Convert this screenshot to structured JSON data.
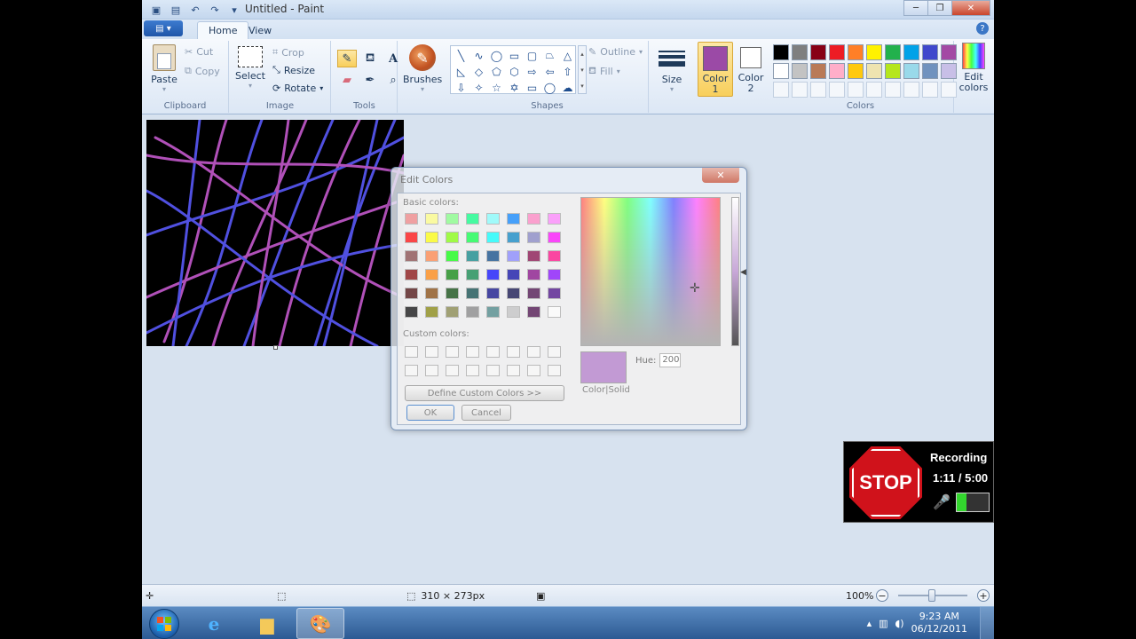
{
  "window": {
    "title": "Untitled - Paint",
    "controls": [
      "─",
      "❐",
      "✕"
    ]
  },
  "qat": {
    "save": "💾",
    "undo": "↶",
    "redo": "↷",
    "more": "▾"
  },
  "tabs": [
    {
      "label": "Home",
      "active": true
    },
    {
      "label": "View",
      "active": false
    }
  ],
  "ribbon": {
    "clipboard": {
      "label": "Clipboard",
      "paste": "Paste",
      "cut": "Cut",
      "copy": "Copy"
    },
    "image": {
      "label": "Image",
      "select": "Select",
      "crop": "Crop",
      "resize": "Resize",
      "rotate": "Rotate"
    },
    "tools": {
      "label": "Tools"
    },
    "brushes": {
      "label": "Brushes"
    },
    "shapes": {
      "label": "Shapes",
      "outline": "Outline",
      "fill": "Fill"
    },
    "size": {
      "label": "Size"
    },
    "colors": {
      "label": "Colors",
      "color1": "Color 1",
      "color2": "Color 2",
      "color1_value": "#9b4aa6",
      "color2_value": "#ffffff",
      "edit": "Edit colors",
      "palette_row1": [
        "#000000",
        "#7f7f7f",
        "#880015",
        "#ed1c24",
        "#ff7f27",
        "#fff200",
        "#22b14c",
        "#00a2e8",
        "#3f48cc",
        "#a349a4"
      ],
      "palette_row2": [
        "#ffffff",
        "#c3c3c3",
        "#b97a57",
        "#ffaec9",
        "#ffc90e",
        "#efe4b0",
        "#b5e61d",
        "#99d9ea",
        "#7092be",
        "#c8bfe7"
      ]
    }
  },
  "dialog": {
    "title": "Edit Colors",
    "close": "✕",
    "basic_label": "Basic colors:",
    "custom_label": "Custom colors:",
    "define": "Define Custom Colors >>",
    "ok": "OK",
    "cancel": "Cancel",
    "color_solid": "Color|Solid",
    "hue_label": "Hue:",
    "hue_value": "200",
    "basic_colors": [
      "#f08080",
      "#ffff80",
      "#80ff80",
      "#00ff80",
      "#80ffff",
      "#0080ff",
      "#ff80c0",
      "#ff80ff",
      "#ff0000",
      "#ffff00",
      "#80ff00",
      "#00ff40",
      "#00ffff",
      "#0080c0",
      "#8080c0",
      "#ff00ff",
      "#804040",
      "#ff8040",
      "#00ff00",
      "#008080",
      "#004080",
      "#8080ff",
      "#800040",
      "#ff0080",
      "#800000",
      "#ff8000",
      "#008000",
      "#008040",
      "#0000ff",
      "#0000a0",
      "#800080",
      "#8000ff",
      "#400000",
      "#804000",
      "#004000",
      "#004040",
      "#000080",
      "#000040",
      "#400040",
      "#400080",
      "#000000",
      "#808000",
      "#808040",
      "#808080",
      "#408080",
      "#c0c0c0",
      "#400040",
      "#ffffff"
    ]
  },
  "status": {
    "dimensions": "310 × 273px",
    "zoom": "100%"
  },
  "taskbar": {
    "time": "9:23 AM",
    "date": "06/12/2011"
  },
  "recorder": {
    "stop": "STOP",
    "label": "Recording",
    "time": "1:11 / 5:00"
  }
}
